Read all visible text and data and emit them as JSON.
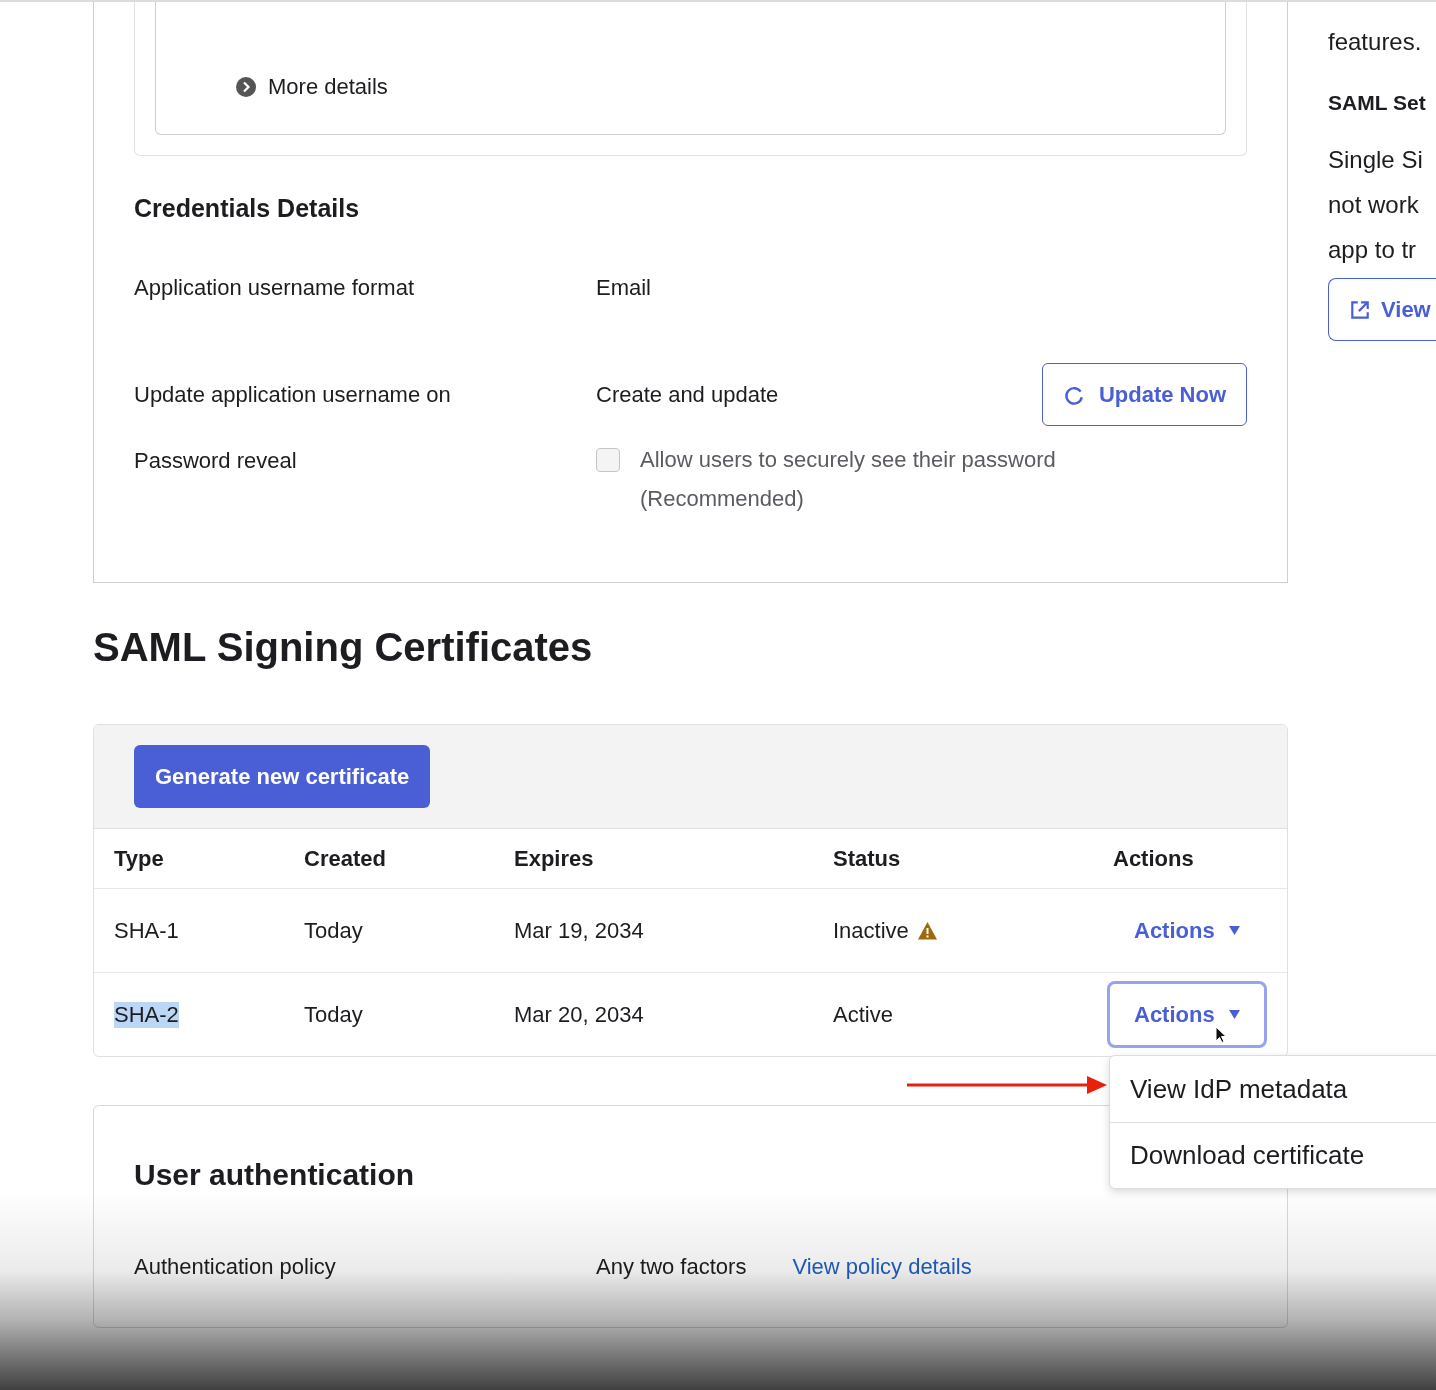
{
  "top_panel": {
    "more_details": "More details"
  },
  "credentials": {
    "title": "Credentials Details",
    "rows": [
      {
        "label": "Application username format",
        "value": "Email"
      },
      {
        "label": "Update application username on",
        "value": "Create and update",
        "button": "Update Now"
      }
    ],
    "password_reveal": {
      "label": "Password reveal",
      "checked": false,
      "text": "Allow users to securely see their password (Recommended)"
    }
  },
  "certificates": {
    "title": "SAML Signing Certificates",
    "generate_button": "Generate new certificate",
    "columns": [
      "Type",
      "Created",
      "Expires",
      "Status",
      "Actions"
    ],
    "rows": [
      {
        "type": "SHA-1",
        "highlighted": false,
        "created": "Today",
        "expires": "Mar 19, 2034",
        "status": "Inactive",
        "warning": true,
        "action": "Actions",
        "focused": false
      },
      {
        "type": "SHA-2",
        "highlighted": true,
        "created": "Today",
        "expires": "Mar 20, 2034",
        "status": "Active",
        "warning": false,
        "action": "Actions",
        "focused": true,
        "menu": [
          "View IdP metadata",
          "Download certificate"
        ]
      }
    ]
  },
  "user_authentication": {
    "title": "User authentication",
    "label": "Authentication policy",
    "value": "Any two factors",
    "link": "View policy details"
  },
  "side_panel": {
    "lines_top": [
      "features."
    ],
    "title": "SAML Set",
    "lines": [
      "Single Si",
      "not work",
      "app to tr"
    ],
    "button": "View"
  }
}
